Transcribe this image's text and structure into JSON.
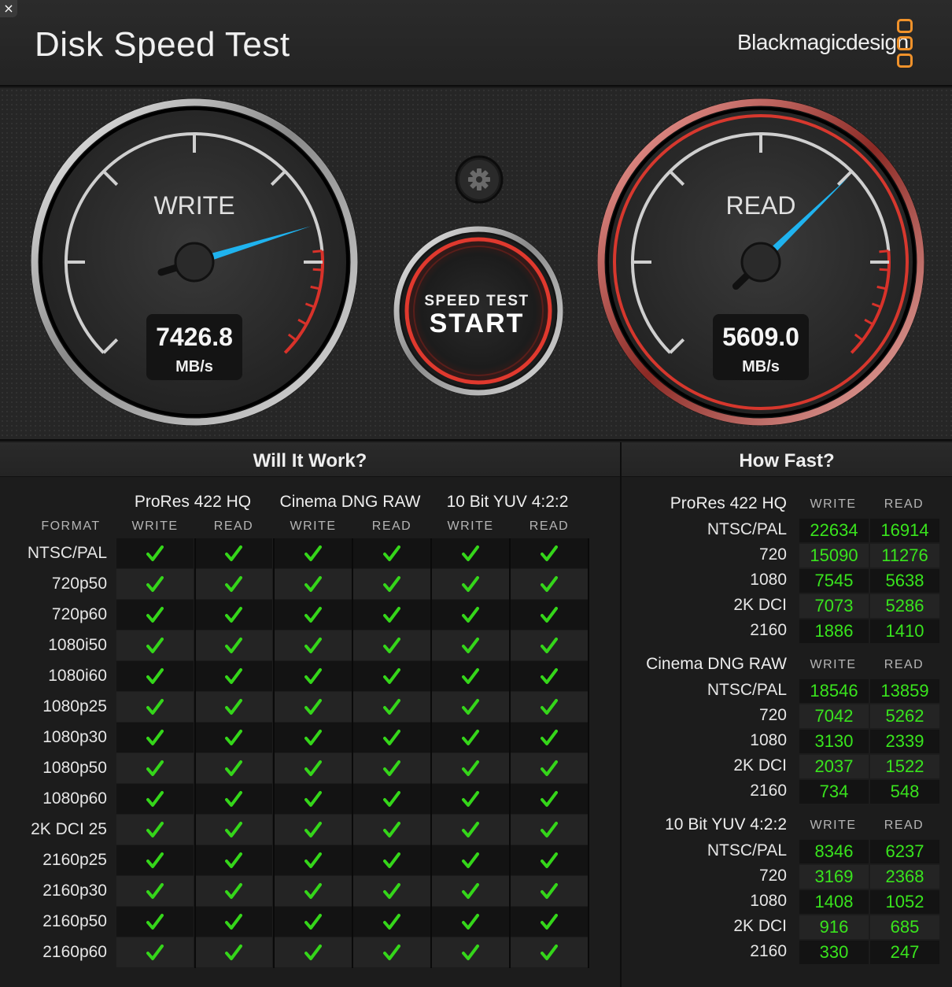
{
  "window": {
    "close_glyph": "×",
    "title": "Disk Speed Test",
    "brand": "Blackmagicdesign",
    "brand_logo_icon": "blackmagic-logo-icon"
  },
  "colors": {
    "accent_orange": "#f0922b",
    "needle_blue": "#1fb3ef",
    "gauge_red": "#d8322a",
    "value_green": "#39e41d",
    "check_green": "#35d61a"
  },
  "gauges": {
    "write": {
      "label": "WRITE",
      "value": "7426.8",
      "unit": "MB/s",
      "needle_fraction": 0.77
    },
    "read": {
      "label": "READ",
      "value": "5609.0",
      "unit": "MB/s",
      "needle_fraction": 0.67
    }
  },
  "settings_icon": "gear-icon",
  "start_button": {
    "line1": "SPEED TEST",
    "line2": "START"
  },
  "will_it_work": {
    "title": "Will It Work?",
    "format_header": "FORMAT",
    "codecs": [
      "ProRes 422 HQ",
      "Cinema DNG RAW",
      "10 Bit YUV 4:2:2"
    ],
    "subheaders": [
      "WRITE",
      "READ",
      "WRITE",
      "READ",
      "WRITE",
      "READ"
    ],
    "formats": [
      "NTSC/PAL",
      "720p50",
      "720p60",
      "1080i50",
      "1080i60",
      "1080p25",
      "1080p30",
      "1080p50",
      "1080p60",
      "2K DCI 25",
      "2160p25",
      "2160p30",
      "2160p50",
      "2160p60"
    ],
    "all_supported": true
  },
  "how_fast": {
    "title": "How Fast?",
    "write_header": "WRITE",
    "read_header": "READ",
    "groups": [
      {
        "codec": "ProRes 422 HQ",
        "rows": [
          {
            "label": "NTSC/PAL",
            "write": "22634",
            "read": "16914"
          },
          {
            "label": "720",
            "write": "15090",
            "read": "11276"
          },
          {
            "label": "1080",
            "write": "7545",
            "read": "5638"
          },
          {
            "label": "2K DCI",
            "write": "7073",
            "read": "5286"
          },
          {
            "label": "2160",
            "write": "1886",
            "read": "1410"
          }
        ]
      },
      {
        "codec": "Cinema DNG RAW",
        "rows": [
          {
            "label": "NTSC/PAL",
            "write": "18546",
            "read": "13859"
          },
          {
            "label": "720",
            "write": "7042",
            "read": "5262"
          },
          {
            "label": "1080",
            "write": "3130",
            "read": "2339"
          },
          {
            "label": "2K DCI",
            "write": "2037",
            "read": "1522"
          },
          {
            "label": "2160",
            "write": "734",
            "read": "548"
          }
        ]
      },
      {
        "codec": "10 Bit YUV 4:2:2",
        "rows": [
          {
            "label": "NTSC/PAL",
            "write": "8346",
            "read": "6237"
          },
          {
            "label": "720",
            "write": "3169",
            "read": "2368"
          },
          {
            "label": "1080",
            "write": "1408",
            "read": "1052"
          },
          {
            "label": "2K DCI",
            "write": "916",
            "read": "685"
          },
          {
            "label": "2160",
            "write": "330",
            "read": "247"
          }
        ]
      }
    ]
  }
}
